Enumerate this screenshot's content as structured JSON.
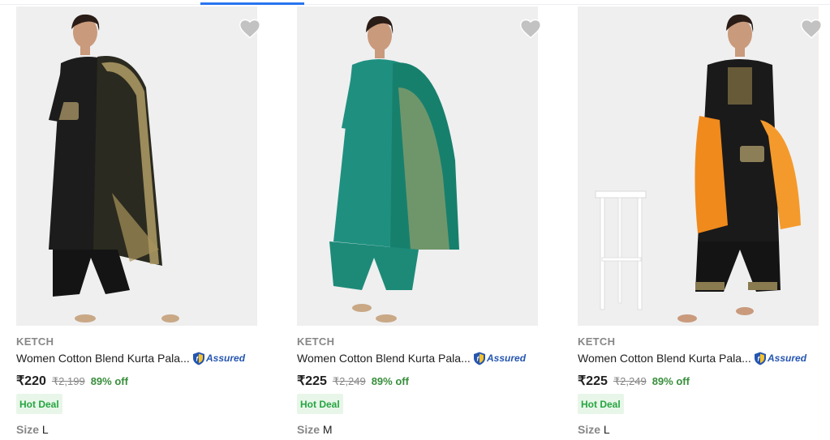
{
  "colors": {
    "accent": "#2874f0",
    "green": "#388e3c",
    "deal_bg": "#e8f6e9",
    "muted": "#878787"
  },
  "products": [
    {
      "brand": "KETCH",
      "title": "Women Cotton Blend Kurta Pala...",
      "assured": "Assured",
      "price": "₹220",
      "mrp": "₹2,199",
      "discount": "89% off",
      "deal": "Hot Deal",
      "size_label": "Size",
      "size": "L",
      "image_alt": "black kurta with gold dupatta"
    },
    {
      "brand": "KETCH",
      "title": "Women Cotton Blend Kurta Pala...",
      "assured": "Assured",
      "price": "₹225",
      "mrp": "₹2,249",
      "discount": "89% off",
      "deal": "Hot Deal",
      "size_label": "Size",
      "size": "M",
      "image_alt": "teal kurta with teal dupatta"
    },
    {
      "brand": "KETCH",
      "title": "Women Cotton Blend Kurta Pala...",
      "assured": "Assured",
      "price": "₹225",
      "mrp": "₹2,249",
      "discount": "89% off",
      "deal": "Hot Deal",
      "size_label": "Size",
      "size": "L",
      "image_alt": "black kurta with orange dupatta"
    }
  ],
  "icons": {
    "wishlist": "heart-icon",
    "assured": "shield-icon"
  }
}
